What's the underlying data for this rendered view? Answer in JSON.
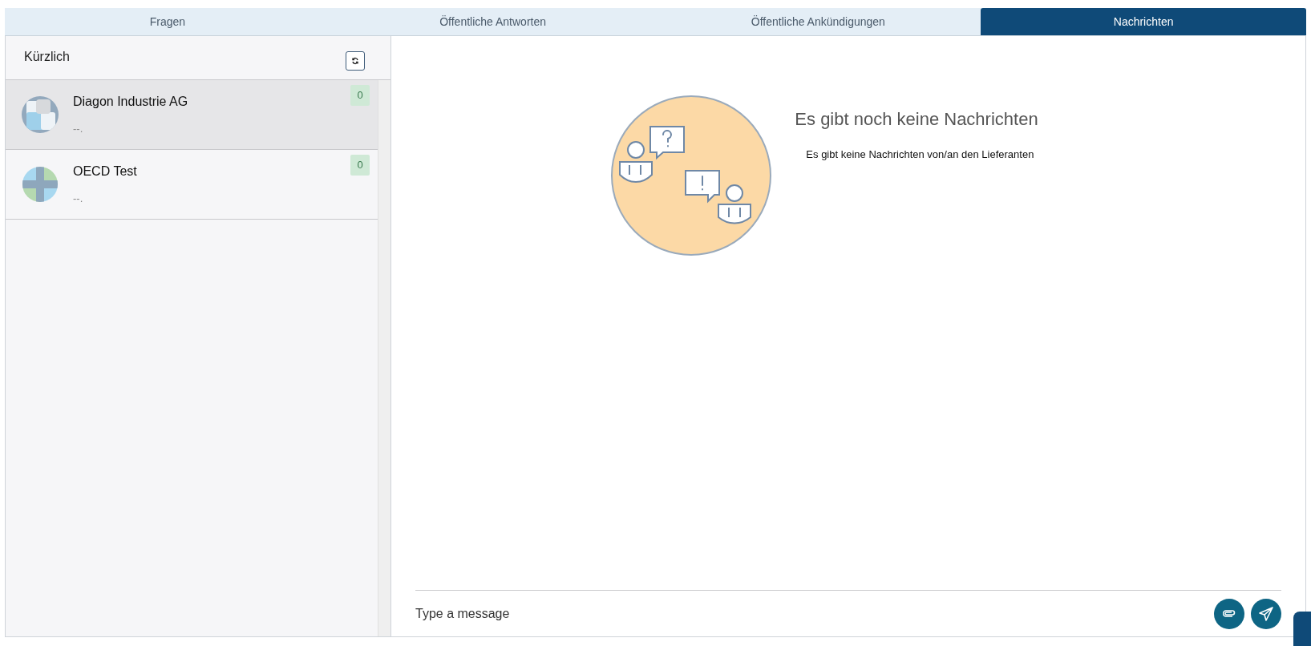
{
  "tabs": [
    {
      "label": "Fragen",
      "selected": false
    },
    {
      "label": "Öffentliche Antworten",
      "selected": false
    },
    {
      "label": "Öffentliche Ankündigungen",
      "selected": false
    },
    {
      "label": "Nachrichten",
      "selected": true
    }
  ],
  "sidebar": {
    "title": "Kürzlich",
    "conversations": [
      {
        "name": "Diagon Industrie AG",
        "preview": "--.",
        "count": "0",
        "selected": true,
        "kind": "squares"
      },
      {
        "name": "OECD Test",
        "preview": "--.",
        "count": "0",
        "selected": false,
        "kind": "cross"
      }
    ]
  },
  "empty_state": {
    "title": "Es gibt noch keine Nachrichten",
    "text": "Es gibt keine Nachrichten von/an den Lieferanten"
  },
  "composer": {
    "placeholder": "Type a message"
  }
}
